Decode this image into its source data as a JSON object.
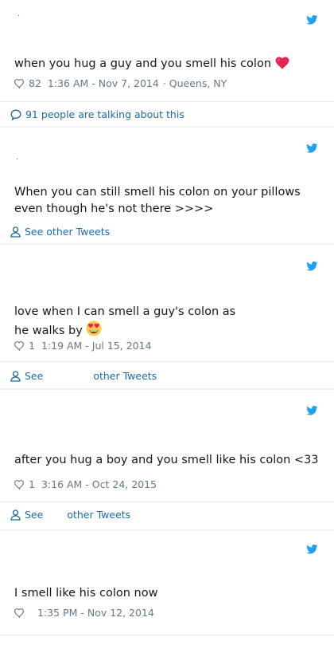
{
  "tweets": [
    {
      "text": "when you hug a guy and you smell his colon",
      "emoji": "heart",
      "likes": "82",
      "timestamp": "1:36 AM - Nov 7, 2014",
      "location": "· Queens, NY",
      "footer": "91 people are talking about this"
    },
    {
      "text": "When you can still smell his colon on your pillows even though he's not there >>>>",
      "footer": "See other Tweets"
    },
    {
      "text_line1": "love when I can smell a guy's colon as",
      "text_line2": "he walks by",
      "emoji": "heart-eyes",
      "likes": "1",
      "timestamp": "1:19 AM - Jul 15, 2014",
      "footer_a": "See",
      "footer_b": "other Tweets"
    },
    {
      "text": "after you hug a boy and you smell like his colon <33",
      "likes": "1",
      "timestamp": "3:16 AM - Oct 24, 2015",
      "footer_a": "See",
      "footer_b": "other Tweets"
    },
    {
      "text": "I smell like his colon now",
      "likes": "",
      "timestamp": "1:35 PM - Nov 12, 2014"
    }
  ],
  "icons": {
    "brand": "twitter-bird-icon",
    "like": "heart-outline-icon",
    "talk": "speech-bubble-icon",
    "profile": "person-icon"
  },
  "colors": {
    "twitter_blue": "#1da1f2",
    "link_blue": "#1b6aa5",
    "muted": "#657786",
    "text": "#14171a",
    "divider": "#e6ecf0"
  }
}
